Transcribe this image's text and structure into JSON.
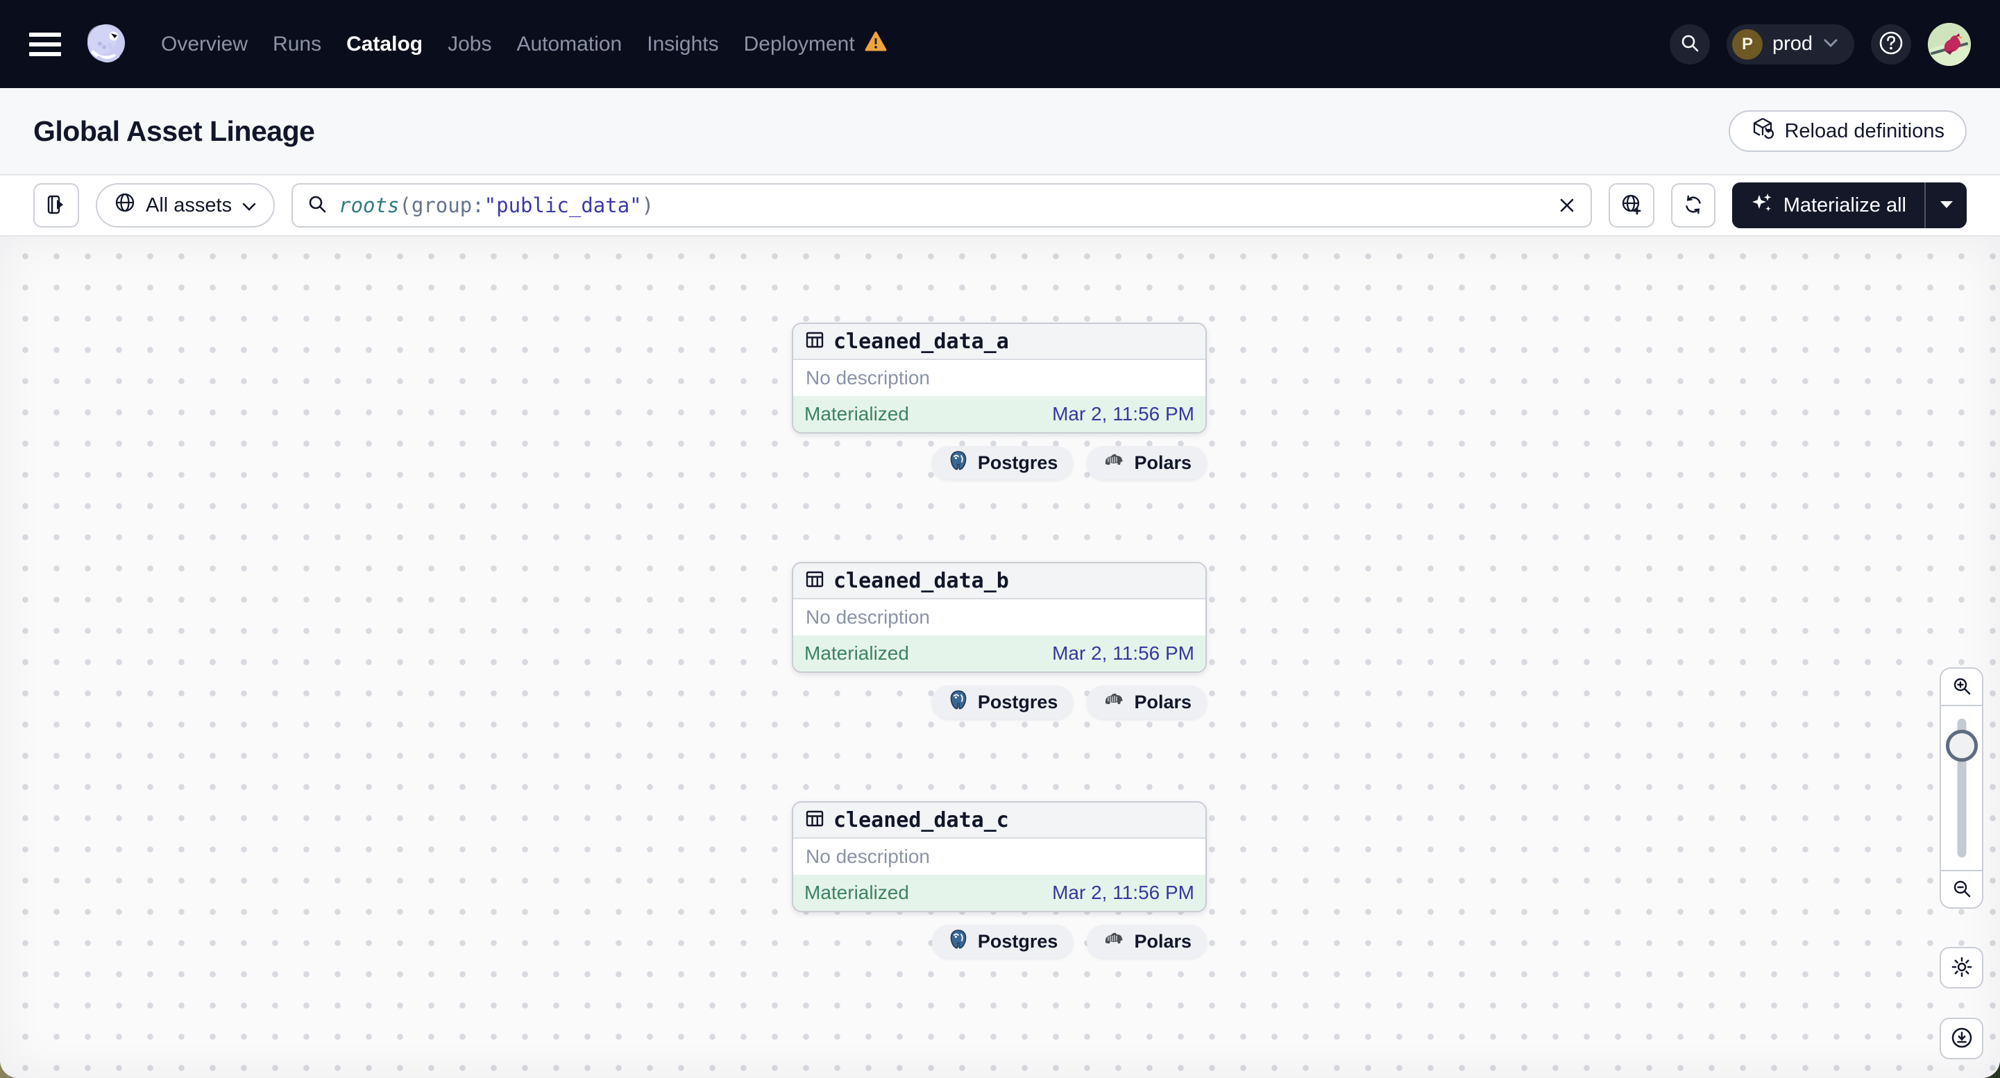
{
  "nav": {
    "items": [
      {
        "label": "Overview",
        "active": false
      },
      {
        "label": "Runs",
        "active": false
      },
      {
        "label": "Catalog",
        "active": true
      },
      {
        "label": "Jobs",
        "active": false
      },
      {
        "label": "Automation",
        "active": false
      },
      {
        "label": "Insights",
        "active": false
      },
      {
        "label": "Deployment",
        "active": false,
        "warning": true
      }
    ],
    "environment": {
      "initial": "P",
      "name": "prod"
    }
  },
  "page": {
    "title": "Global Asset Lineage",
    "reload_button": "Reload definitions"
  },
  "toolbar": {
    "scope_label": "All assets",
    "query": {
      "fn": "roots",
      "open": "(",
      "field": "group:",
      "value": "\"public_data\"",
      "close": ")"
    },
    "materialize_label": "Materialize all"
  },
  "graph": {
    "nodes": [
      {
        "name": "cleaned_data_a",
        "description": "No description",
        "status": "Materialized",
        "timestamp": "Mar 2, 11:56 PM",
        "tags": [
          "Postgres",
          "Polars"
        ]
      },
      {
        "name": "cleaned_data_b",
        "description": "No description",
        "status": "Materialized",
        "timestamp": "Mar 2, 11:56 PM",
        "tags": [
          "Postgres",
          "Polars"
        ]
      },
      {
        "name": "cleaned_data_c",
        "description": "No description",
        "status": "Materialized",
        "timestamp": "Mar 2, 11:56 PM",
        "tags": [
          "Postgres",
          "Polars"
        ]
      }
    ]
  },
  "icons": {
    "nav_warning": "warning-triangle",
    "tag_icons": [
      "postgres-elephant",
      "polars-bear"
    ]
  },
  "colors": {
    "topnav_bg": "#0A0D1B",
    "nav_inactive": "#8C93A6",
    "warning_orange": "#EFA43B",
    "status_green_bg": "#E5F4EB",
    "status_green_text": "#3D8361",
    "timestamp_indigo": "#37389E",
    "query_fn_teal": "#2E7C85",
    "query_value_indigo": "#3A39A8",
    "materialize_bg": "#141829"
  }
}
